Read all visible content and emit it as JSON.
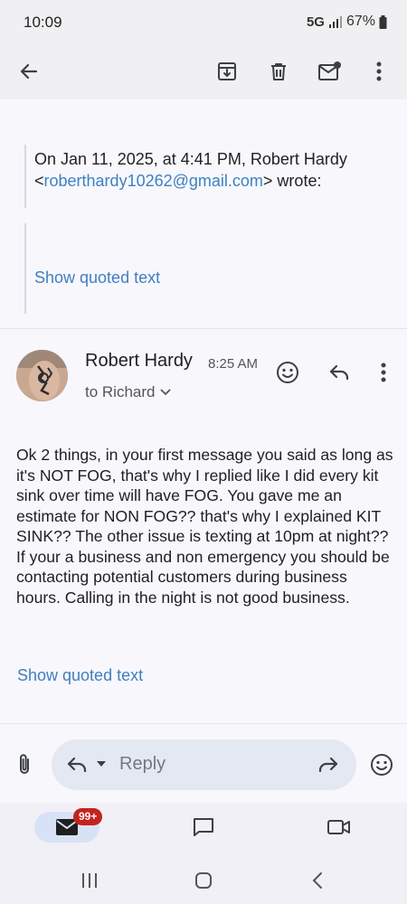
{
  "status": {
    "time": "10:09",
    "network": "5G",
    "battery": "67%"
  },
  "toolbar": {
    "icons": [
      "back-arrow-icon",
      "archive-icon",
      "trash-icon",
      "mark-unread-icon",
      "more-vert-icon"
    ]
  },
  "quoted": {
    "header_prefix": "On Jan 11, 2025, at 4:41 PM, Robert Hardy <",
    "email": "roberthardy10262@gmail.com",
    "header_suffix": "> wrote:",
    "show_quoted_label": "Show quoted text"
  },
  "message": {
    "sender": "Robert Hardy",
    "time": "8:25 AM",
    "recipient": "to Richard",
    "body": "Ok 2 things, in your first message you said as long as it's NOT FOG, that's why I replied like I did every kit sink over time will have FOG. You gave me an estimate for NON FOG?? that's why I explained KIT SINK?? The other issue is texting at 10pm at night?? If your a business and non emergency you should be contacting potential customers during business hours. Calling in the night is not good business.",
    "show_quoted_label": "Show quoted text"
  },
  "reply_bar": {
    "placeholder": "Reply"
  },
  "bottom_nav": {
    "mail_badge": "99+"
  },
  "colors": {
    "link": "#3b82c4",
    "badge": "#c5221f",
    "pill": "#e4e8f2"
  }
}
